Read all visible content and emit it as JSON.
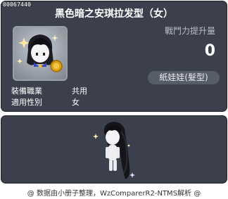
{
  "item": {
    "id": "00067440",
    "title": "黑色暗之安琪拉发型（女）",
    "icon": "doll-hairstyle-icon",
    "stat_label": "戰鬥力提升量",
    "stat_value": "0",
    "category": "紙娃娃(髮型)",
    "job_label": "裝備職業",
    "job_value": "共用",
    "gender_label": "適用性別",
    "gender_value": "女"
  },
  "preview": {
    "character": "character-preview-icon"
  },
  "footer": {
    "text": "@ 数据由小册子整理，WzComparerR2-NTMS解析 @"
  },
  "colors": {
    "panel_bg": "#3b404c",
    "badge_bg": "#565c68",
    "text": "#ffffff",
    "muted_text": "#b9bec8"
  }
}
